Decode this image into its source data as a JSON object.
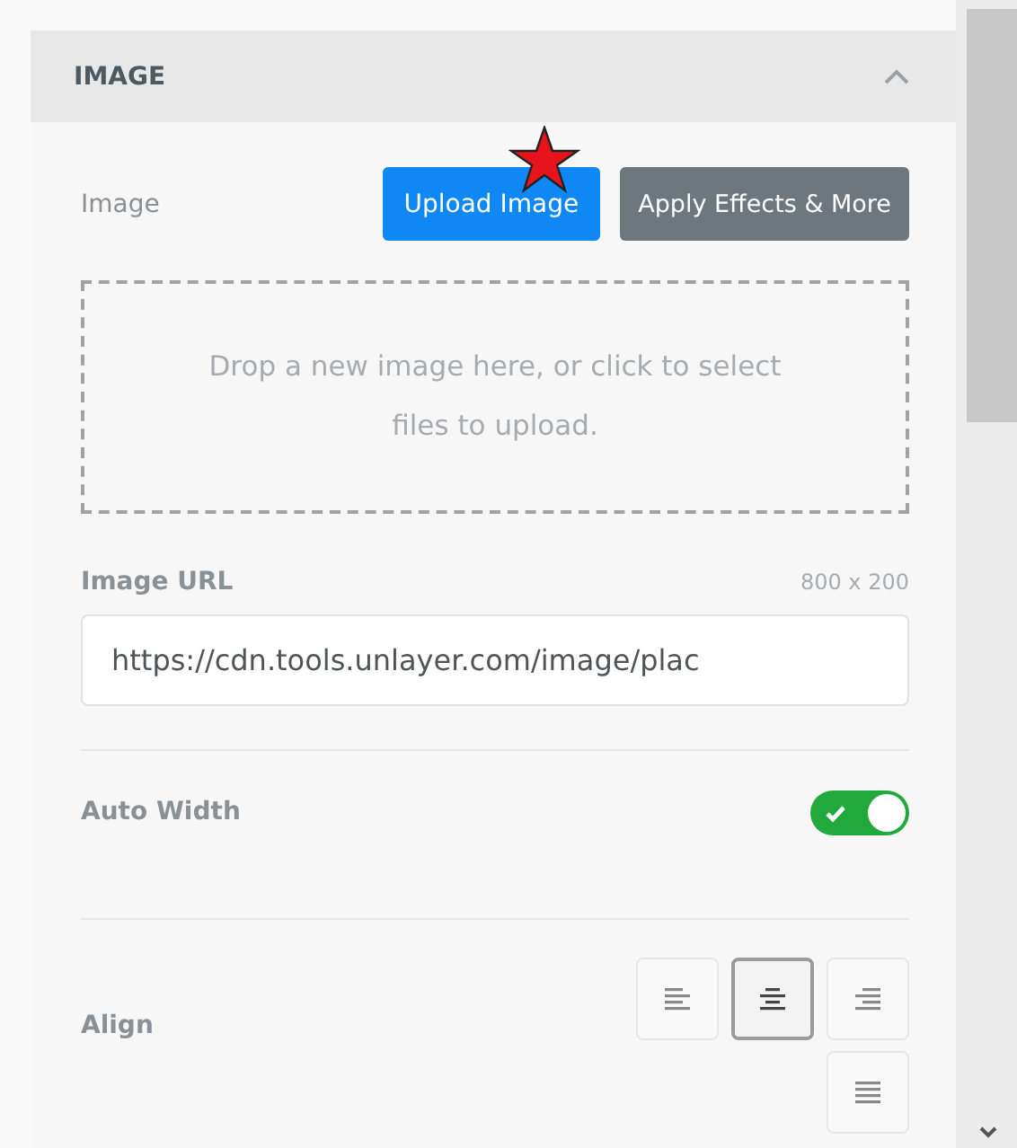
{
  "section": {
    "title": "IMAGE",
    "expanded": true
  },
  "image_row": {
    "label": "Image",
    "buttons": [
      {
        "label": "Upload Image",
        "kind": "primary"
      },
      {
        "label": "Apply Effects & More",
        "kind": "secondary"
      }
    ]
  },
  "dropzone": {
    "text": "Drop a new image here, or click to select files to upload."
  },
  "image_url": {
    "label": "Image URL",
    "size": "800 x 200",
    "value": "https://cdn.tools.unlayer.com/image/plac"
  },
  "auto_width": {
    "label": "Auto Width",
    "on": true
  },
  "align": {
    "label": "Align",
    "options": [
      {
        "kind": "left",
        "selected": false
      },
      {
        "kind": "center",
        "selected": true
      },
      {
        "kind": "right",
        "selected": false
      },
      {
        "kind": "justify",
        "selected": false
      }
    ]
  }
}
